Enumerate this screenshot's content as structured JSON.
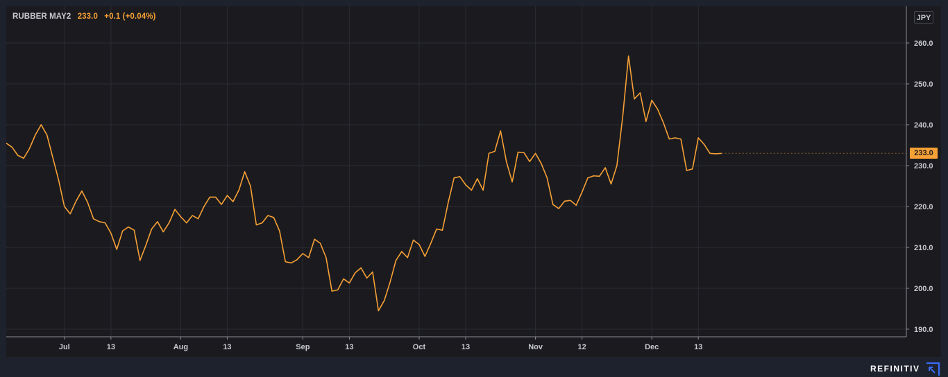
{
  "chart_data": {
    "type": "line",
    "title": "RUBBER MAY2",
    "last_value": "233.0",
    "change": "+0.1",
    "change_pct": "(+0.04%)",
    "currency": "JPY",
    "last_badge": "233.0",
    "xlabel": "",
    "ylabel": "",
    "ylim": [
      188,
      265
    ],
    "y_ticks": [
      "190.0",
      "200.0",
      "210.0",
      "220.0",
      "230.0",
      "240.0",
      "250.0",
      "260.0"
    ],
    "y_tick_values": [
      190,
      200,
      210,
      220,
      230,
      240,
      250,
      260
    ],
    "x_ticks": [
      "Jul",
      "13",
      "Aug",
      "13",
      "Sep",
      "13",
      "Oct",
      "13",
      "Nov",
      "12",
      "Dec",
      "13"
    ],
    "x_tick_index": [
      10,
      18,
      30,
      38,
      51,
      59,
      71,
      79,
      91,
      99,
      111,
      119
    ],
    "grid": true,
    "line_color": "#f7a035",
    "series": [
      {
        "values": [
          235.5,
          234.5,
          232.5,
          231.8,
          234.2,
          237.5,
          240.0,
          237.5,
          232.0,
          226.5,
          220.0,
          218.2,
          221.3,
          223.8,
          221.0,
          217.0,
          216.3,
          216.0,
          213.5,
          209.5,
          214.0,
          215.0,
          214.2,
          206.8,
          210.5,
          214.5,
          216.3,
          213.8,
          216.0,
          219.3,
          217.5,
          216.0,
          217.8,
          217.0,
          220.0,
          222.3,
          222.3,
          220.5,
          222.7,
          221.2,
          224.0,
          228.5,
          225.0,
          215.5,
          216.0,
          217.8,
          217.3,
          214.0,
          206.5,
          206.2,
          207.0,
          208.5,
          207.5,
          212.0,
          211.0,
          207.5,
          199.3,
          199.6,
          202.3,
          201.3,
          203.8,
          205.0,
          202.5,
          204.0,
          194.5,
          197.0,
          201.5,
          206.8,
          209.0,
          207.5,
          211.8,
          210.7,
          207.8,
          211.0,
          214.5,
          214.2,
          221.0,
          227.0,
          227.3,
          225.3,
          224.0,
          226.8,
          224.0,
          233.0,
          233.5,
          238.5,
          231.0,
          226.0,
          233.3,
          233.2,
          231.0,
          233.0,
          230.5,
          227.0,
          220.5,
          219.5,
          221.3,
          221.5,
          220.3,
          223.5,
          227.0,
          227.5,
          227.4,
          229.5,
          225.5,
          230.0,
          242.0,
          256.8,
          246.3,
          247.8,
          240.8,
          246.0,
          243.8,
          240.5,
          236.5,
          236.8,
          236.5,
          228.8,
          229.2,
          236.8,
          235.2,
          233.0,
          232.9,
          233.0
        ]
      }
    ]
  },
  "footer": {
    "brand": "REFINITIV",
    "logo_icon": "refinitiv-arrow-icon"
  },
  "colors": {
    "background": "#1e222d",
    "panel": "#1b1b1f",
    "grid": "#2a2c33",
    "axis_text": "#c8cad0",
    "accent": "#f7a035"
  }
}
